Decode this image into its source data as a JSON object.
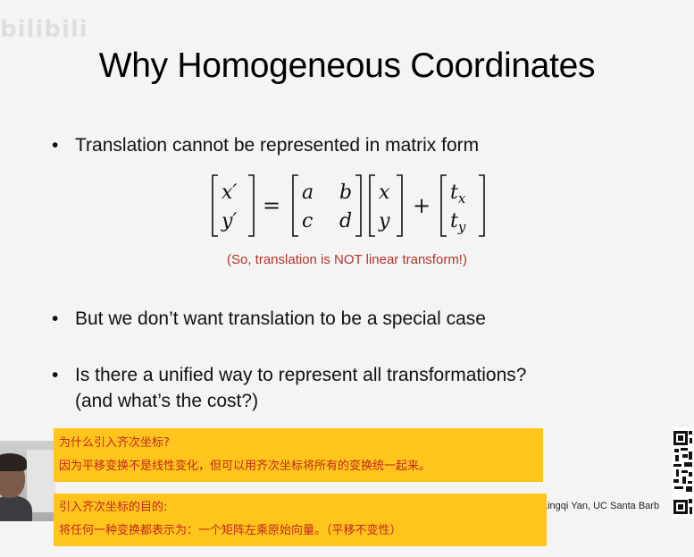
{
  "watermark": "bilibili",
  "slide": {
    "title": "Why Homogeneous Coordinates",
    "bullets": {
      "b1": "Translation cannot be represented in matrix form",
      "b2": "But we don’t want translation to be a special case",
      "b3_line1": "Is there a unified way to represent all transformations?",
      "b3_line2": "(and what’s the cost?)",
      "marker": "•"
    },
    "equation": {
      "lhs": [
        "x′",
        "y′"
      ],
      "matrix": [
        [
          "a",
          "b"
        ],
        [
          "c",
          "d"
        ]
      ],
      "vector": [
        "x",
        "y"
      ],
      "translation": [
        "t",
        "t"
      ],
      "translation_subscripts": [
        "x",
        "y"
      ],
      "equals": "=",
      "plus": "+"
    },
    "note": "(So, translation is NOT linear transform!)",
    "credit": "Lingqi Yan, UC Santa Barb"
  },
  "subtitles": {
    "box1": {
      "line1": "为什么引入齐次坐标?",
      "line2": "因为平移变换不是线性变化，但可以用齐次坐标将所有的变换统一起来。"
    },
    "box2": {
      "line1": "引入齐次坐标的目的:",
      "line2": "将任何一种变换都表示为：一个矩阵左乘原始向量。（平移不变性）"
    }
  },
  "colors": {
    "note": "#b4342a",
    "subtitle_bg": "#ffc51d",
    "subtitle_text": "#c0271e",
    "background": "#f4f4f4"
  }
}
